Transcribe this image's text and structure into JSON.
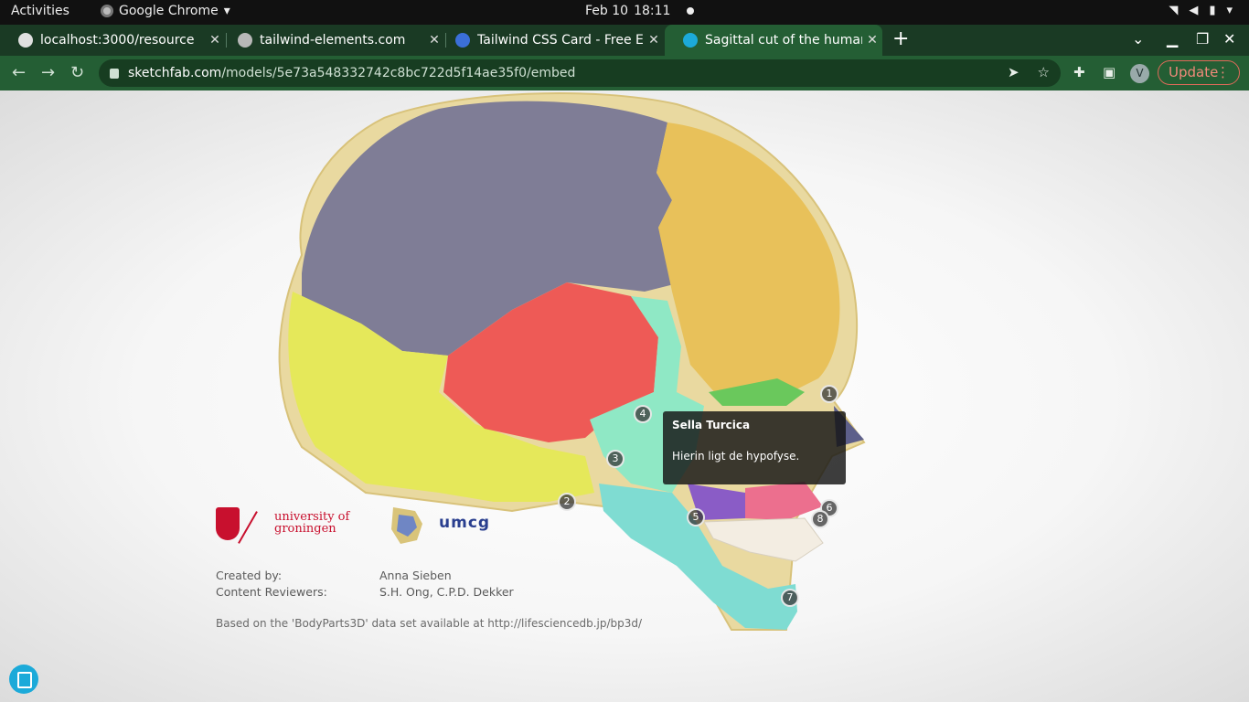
{
  "topbar": {
    "activities": "Activities",
    "app_name": "Google Chrome",
    "date": "Feb 10",
    "time": "18:11"
  },
  "tabs": [
    {
      "title": "localhost:3000/resource",
      "active": false
    },
    {
      "title": "tailwind-elements.com",
      "active": false
    },
    {
      "title": "Tailwind CSS Card - Free E",
      "active": false
    },
    {
      "title": "Sagittal cut of the human",
      "active": true
    }
  ],
  "toolbar": {
    "url_host": "sketchfab.com",
    "url_path": "/models/5e73a548332742c8bc722d5f14ae35f0/embed",
    "avatar_letter": "V",
    "update_label": "Update"
  },
  "viewer": {
    "hotspots": [
      "1",
      "2",
      "3",
      "4",
      "5",
      "6",
      "7",
      "8"
    ],
    "tooltip": {
      "title": "Sella Turcica",
      "text": "Hierin ligt de hypofyse."
    },
    "logos": {
      "rug_line1": "university of",
      "rug_line2": "groningen",
      "umcg": "umcg"
    },
    "credits": {
      "created_by_label": "Created by:",
      "created_by_value": "Anna Sieben",
      "reviewers_label": "Content Reviewers:",
      "reviewers_value": "S.H. Ong, C.P.D. Dekker",
      "source": "Based on the 'BodyParts3D' data set available at http://lifesciencedb.jp/bp3d/"
    }
  },
  "colors": {
    "tabstrip": "#1a3a24",
    "toolbar": "#245e34",
    "parietal": "#7f7d96",
    "frontal": "#e8c15a",
    "occipital": "#e5e85a",
    "temporal": "#ee5a56",
    "sphenoid": "#8fe8c5",
    "mandible": "#7fdcd2"
  }
}
